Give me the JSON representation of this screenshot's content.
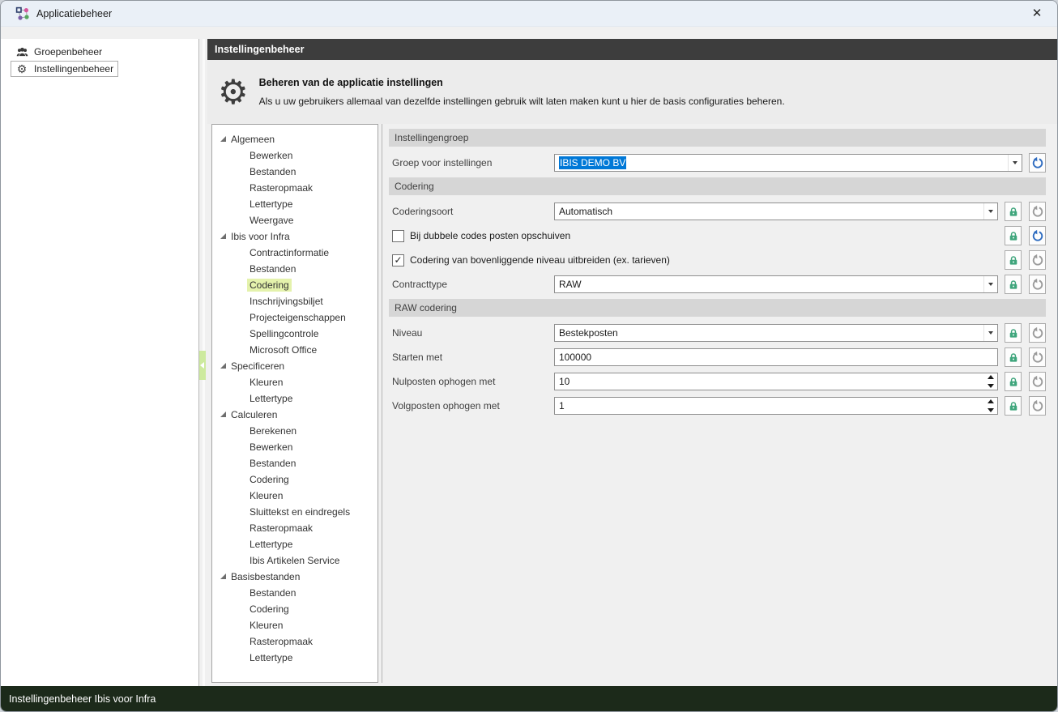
{
  "window": {
    "title": "Applicatiebeheer"
  },
  "icons": {
    "close": "✕",
    "gear": "⚙",
    "check": "✓"
  },
  "colors": {
    "titlebar_bg": "#eaf0f7",
    "header_dark_bg": "#3d3d3d",
    "statusbar_bg": "#1c2a1a",
    "selection_blue": "#0078d7",
    "lock_green": "#3fa57c",
    "undo_blue": "#2f6cc0",
    "undo_gray": "#9b9b9b",
    "tree_highlight": "#e4f2ac"
  },
  "sidebar": {
    "items": [
      {
        "label": "Groepenbeheer",
        "icon": "users-icon",
        "selected": false
      },
      {
        "label": "Instellingenbeheer",
        "icon": "gear-icon",
        "selected": true
      }
    ]
  },
  "main": {
    "header": "Instellingenbeheer",
    "intro": {
      "title": "Beheren van de applicatie instellingen",
      "description": "Als u uw gebruikers allemaal van dezelfde instellingen gebruik wilt laten maken kunt u hier de basis configuraties beheren."
    }
  },
  "tree": {
    "selected": {
      "group": 1,
      "child": 2
    },
    "groups": [
      {
        "label": "Algemeen",
        "expanded": true,
        "children": [
          "Bewerken",
          "Bestanden",
          "Rasteropmaak",
          "Lettertype",
          "Weergave"
        ]
      },
      {
        "label": "Ibis voor Infra",
        "expanded": true,
        "children": [
          "Contractinformatie",
          "Bestanden",
          "Codering",
          "Inschrijvingsbiljet",
          "Projecteigenschappen",
          "Spellingcontrole",
          "Microsoft Office"
        ]
      },
      {
        "label": "Specificeren",
        "expanded": true,
        "children": [
          "Kleuren",
          "Lettertype"
        ]
      },
      {
        "label": "Calculeren",
        "expanded": true,
        "children": [
          "Berekenen",
          "Bewerken",
          "Bestanden",
          "Codering",
          "Kleuren",
          "Sluittekst en eindregels",
          "Rasteropmaak",
          "Lettertype",
          "Ibis Artikelen Service"
        ]
      },
      {
        "label": "Basisbestanden",
        "expanded": true,
        "children": [
          "Bestanden",
          "Codering",
          "Kleuren",
          "Rasteropmaak",
          "Lettertype"
        ]
      }
    ]
  },
  "form": {
    "sections": [
      {
        "title": "Instellingengroep",
        "rows": [
          {
            "kind": "combobox",
            "label": "Groep voor instellingen",
            "value": "IBIS DEMO BV",
            "value_selected": true,
            "lock": false,
            "undo_active": true
          }
        ]
      },
      {
        "title": "Codering",
        "rows": [
          {
            "kind": "combobox",
            "label": "Coderingsoort",
            "value": "Automatisch",
            "value_selected": false,
            "lock": true,
            "undo_active": false
          },
          {
            "kind": "checkbox",
            "label": "Bij dubbele codes posten opschuiven",
            "checked": false,
            "lock": true,
            "undo_active": true
          },
          {
            "kind": "checkbox",
            "label": "Codering van bovenliggende niveau uitbreiden (ex. tarieven)",
            "checked": true,
            "lock": true,
            "undo_active": false
          },
          {
            "kind": "combobox",
            "label": "Contracttype",
            "value": "RAW",
            "value_selected": false,
            "lock": true,
            "undo_active": false
          }
        ]
      },
      {
        "title": "RAW codering",
        "rows": [
          {
            "kind": "combobox",
            "label": "Niveau",
            "value": "Bestekposten",
            "value_selected": false,
            "lock": true,
            "undo_active": false
          },
          {
            "kind": "text",
            "label": "Starten met",
            "value": "100000",
            "lock": true,
            "undo_active": false
          },
          {
            "kind": "spinner",
            "label": "Nulposten ophogen met",
            "value": "10",
            "lock": true,
            "undo_active": false
          },
          {
            "kind": "spinner",
            "label": "Volgposten ophogen met",
            "value": "1",
            "lock": true,
            "undo_active": false
          }
        ]
      }
    ]
  },
  "statusbar": {
    "text": "Instellingenbeheer Ibis voor Infra"
  }
}
